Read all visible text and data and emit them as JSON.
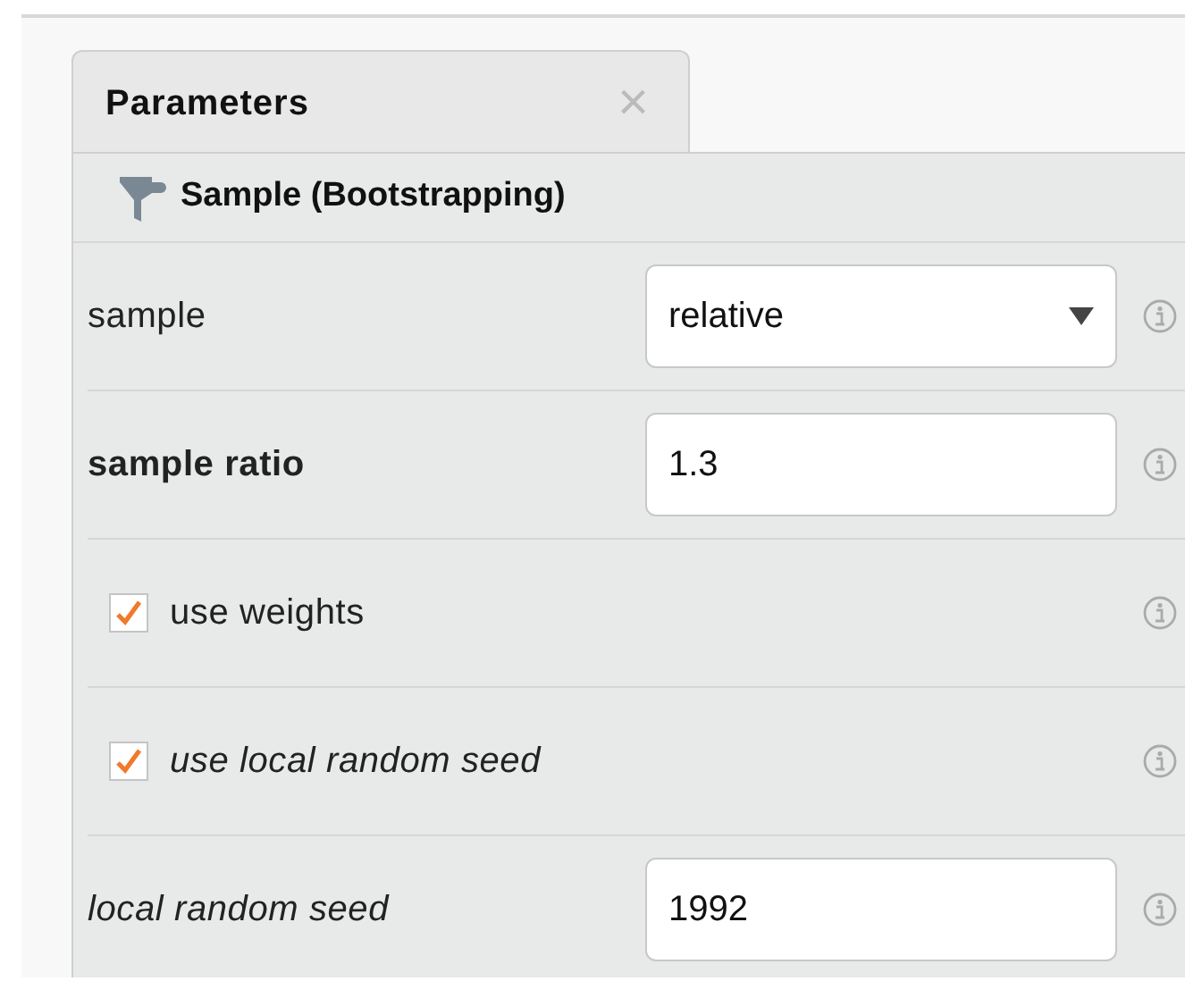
{
  "tab": {
    "label": "Parameters",
    "close": "×",
    "selected": true
  },
  "operator": {
    "name": "Sample (Bootstrapping)"
  },
  "parameters": [
    {
      "kind": "select",
      "label": "sample",
      "bold": false,
      "italic": false,
      "value": "relative"
    },
    {
      "kind": "text",
      "label": "sample ratio",
      "bold": true,
      "italic": false,
      "value": "1.3"
    },
    {
      "kind": "checkbox",
      "label": "use weights",
      "bold": false,
      "italic": false,
      "checked": true
    },
    {
      "kind": "checkbox",
      "label": "use local random seed",
      "bold": false,
      "italic": true,
      "checked": true
    },
    {
      "kind": "text",
      "label": "local random seed",
      "bold": false,
      "italic": true,
      "value": "1992"
    }
  ]
}
